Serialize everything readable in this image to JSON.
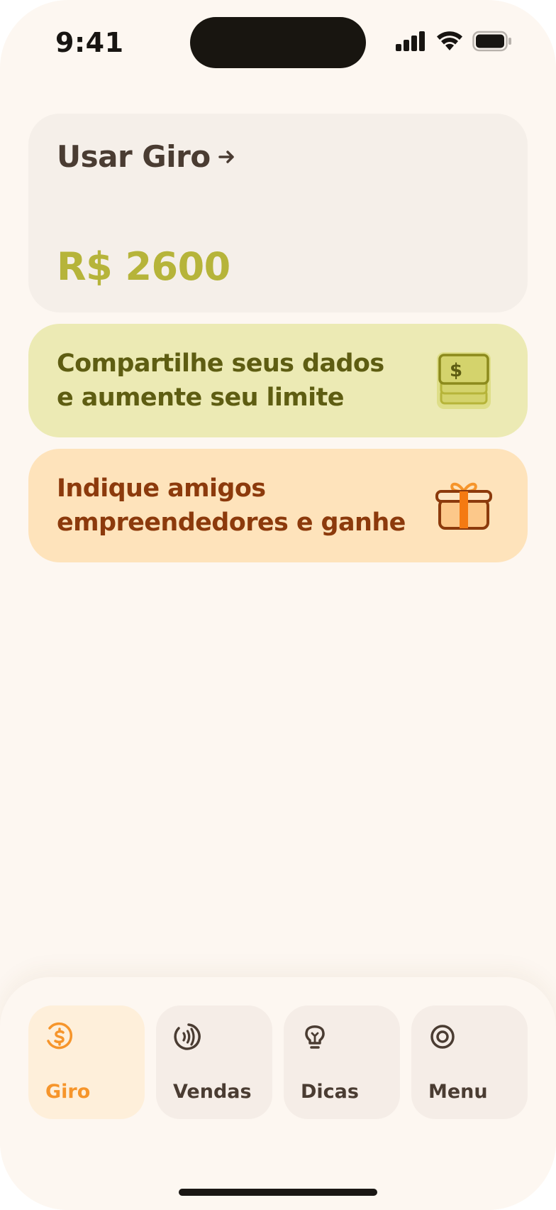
{
  "status_bar": {
    "time": "9:41",
    "icons": [
      "signal-icon",
      "wifi-icon",
      "battery-icon"
    ]
  },
  "giro_card": {
    "title": "Usar Giro",
    "arrow_icon": "arrow-right-icon",
    "amount": "R$ 2600",
    "amount_color": "#b6b43a"
  },
  "promos": [
    {
      "line1": "Compartilhe seus dados",
      "line2": "e aumente seu limite",
      "icon": "money-stack-icon",
      "bg": "#eceab4",
      "text_color": "#5e5d12"
    },
    {
      "line1": "Indique amigos",
      "line2": "empreendedores e ganhe",
      "icon": "gift-icon",
      "bg": "#fee3bb",
      "text_color": "#8c3a0c"
    }
  ],
  "nav": {
    "items": [
      {
        "label": "Giro",
        "icon": "coin-icon",
        "active": true
      },
      {
        "label": "Vendas",
        "icon": "contactless-icon",
        "active": false
      },
      {
        "label": "Dicas",
        "icon": "lightbulb-icon",
        "active": false
      },
      {
        "label": "Menu",
        "icon": "menu-circle-icon",
        "active": false
      }
    ],
    "active_color": "#f6952b"
  }
}
